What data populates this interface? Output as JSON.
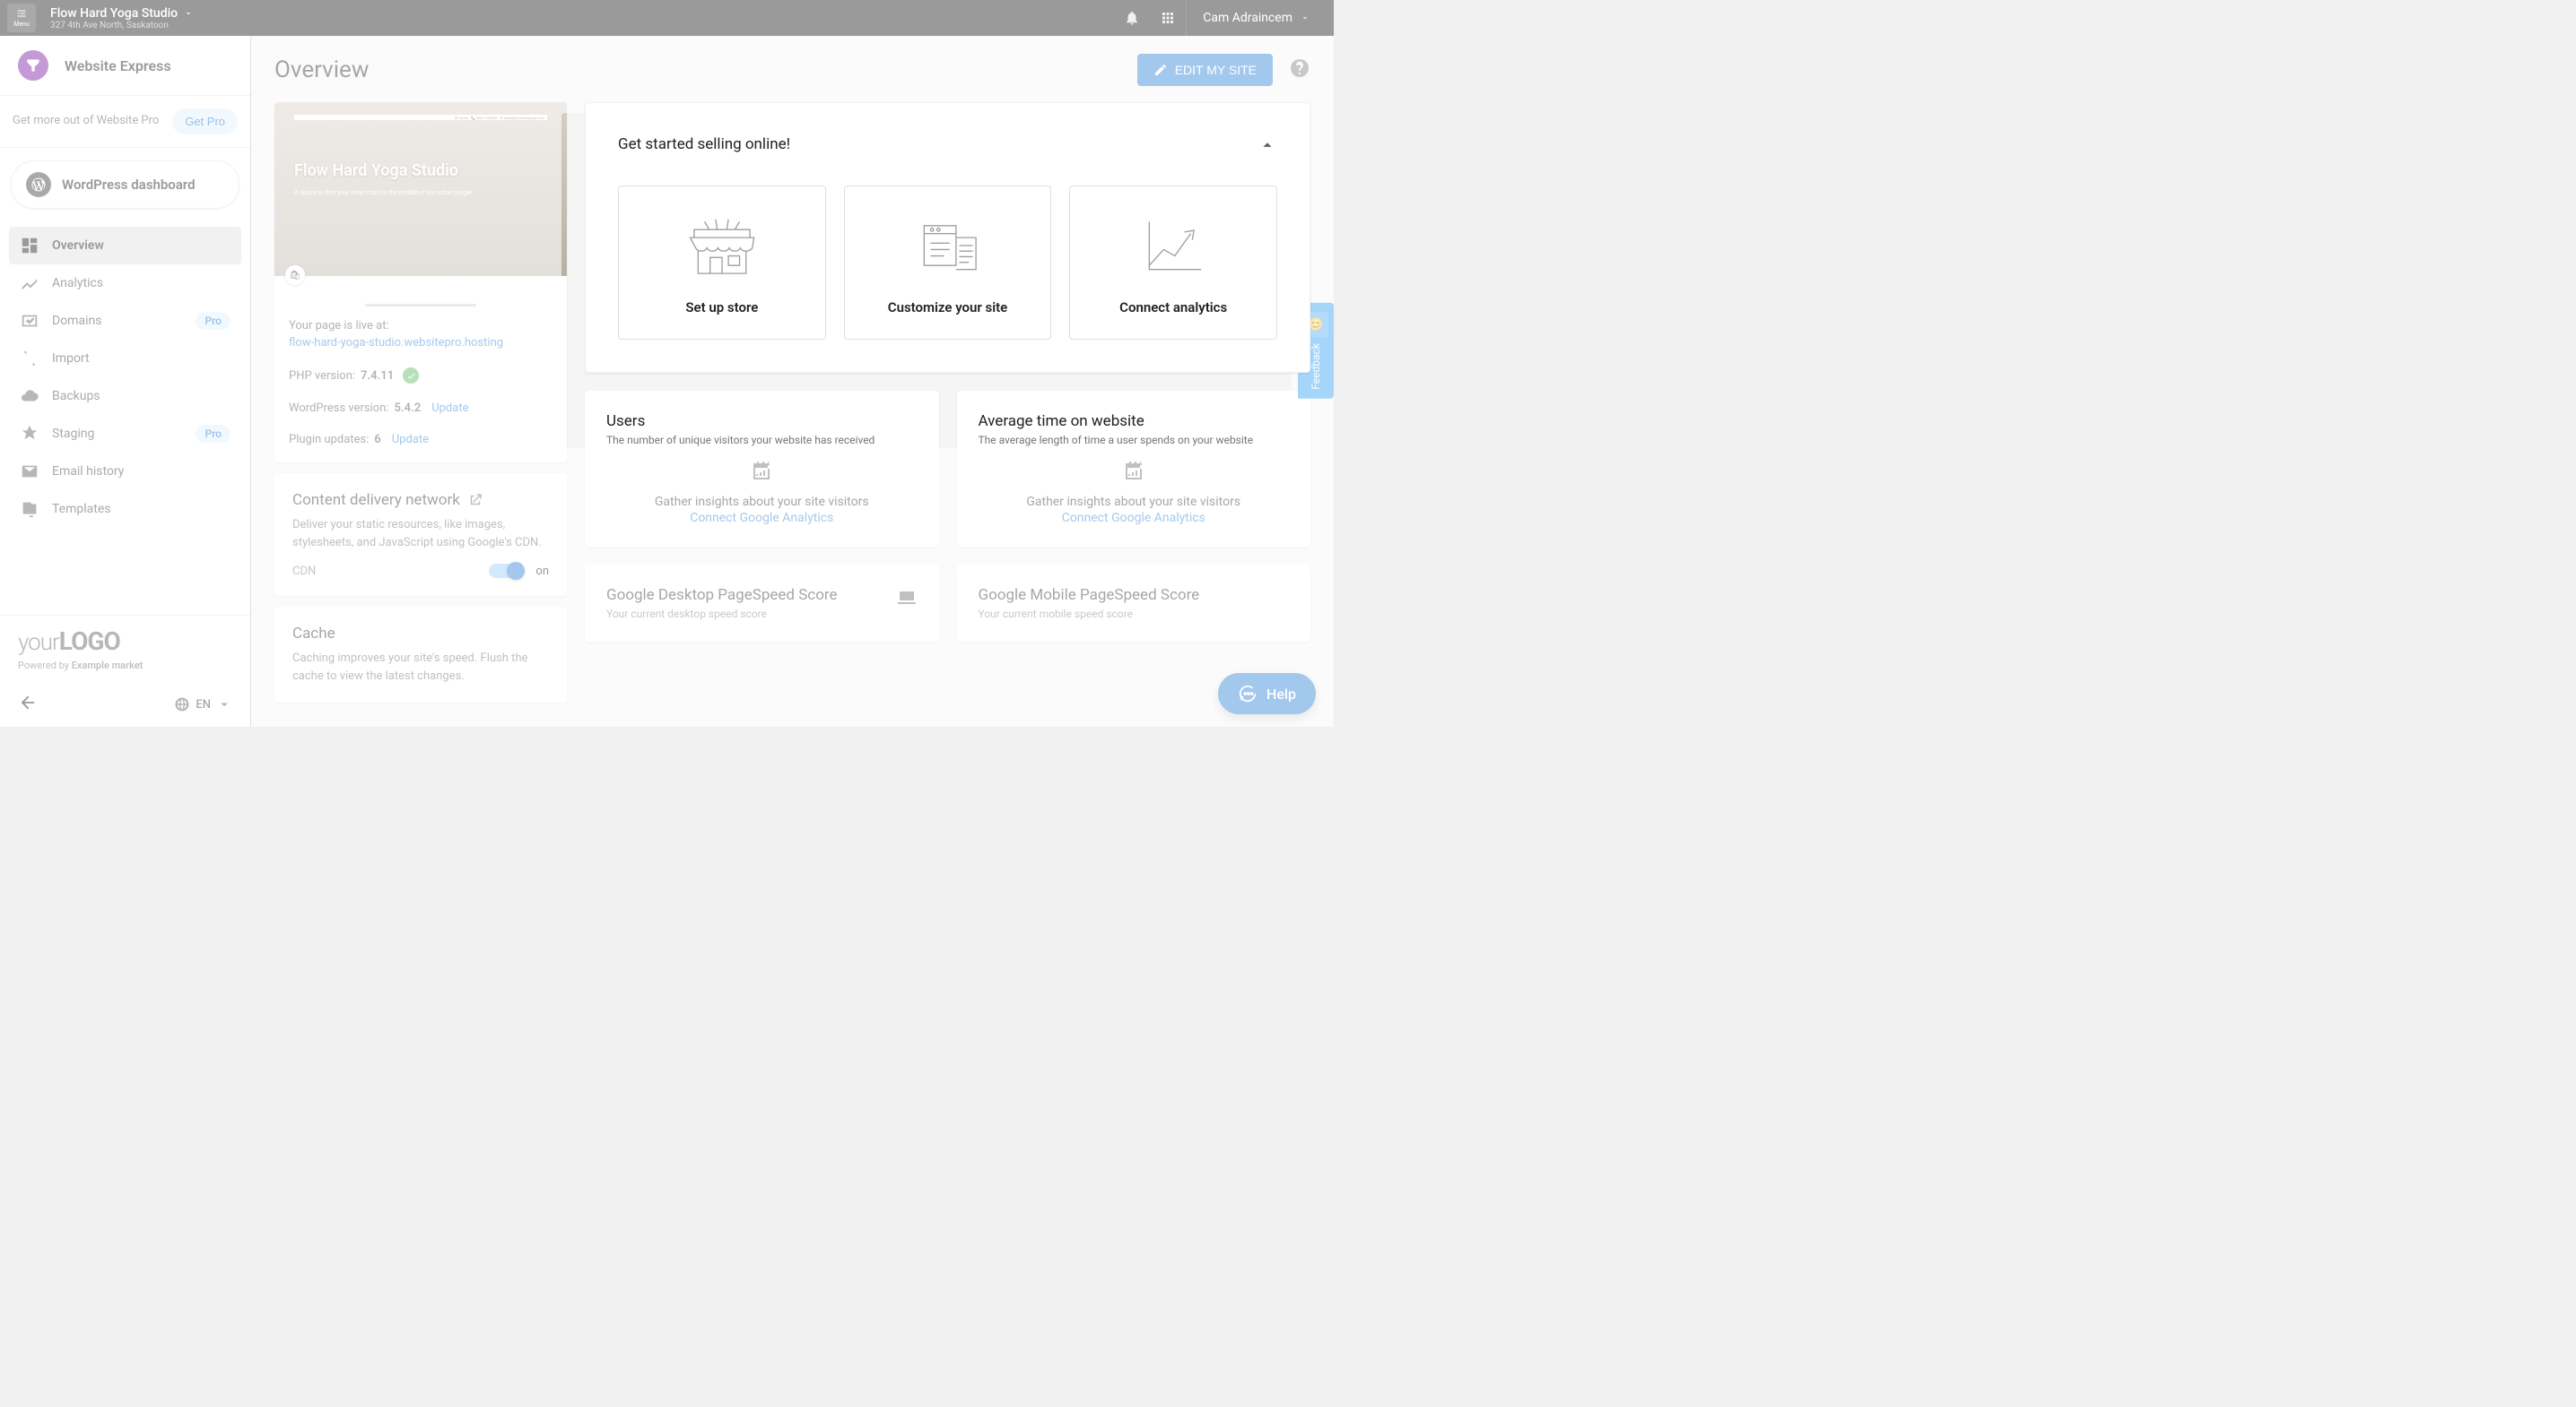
{
  "topbar": {
    "menu_label": "Menu",
    "studio_name": "Flow Hard Yoga Studio",
    "studio_address": "327 4th Ave North, Saskatoon",
    "username": "Cam Adraincem"
  },
  "sidebar": {
    "brand": "Website Express",
    "pro_banner_text": "Get more out of Website Pro",
    "get_pro_label": "Get Pro",
    "wp_dashboard_label": "WordPress dashboard",
    "nav": [
      {
        "label": "Overview",
        "icon": "dashboard",
        "active": true
      },
      {
        "label": "Analytics",
        "icon": "analytics"
      },
      {
        "label": "Domains",
        "icon": "domain",
        "badge": "Pro"
      },
      {
        "label": "Import",
        "icon": "import"
      },
      {
        "label": "Backups",
        "icon": "backup"
      },
      {
        "label": "Staging",
        "icon": "staging",
        "badge": "Pro"
      },
      {
        "label": "Email history",
        "icon": "email"
      },
      {
        "label": "Templates",
        "icon": "templates"
      }
    ],
    "logo_prefix": "your",
    "logo_suffix": "LOGO",
    "powered_prefix": "Powered by ",
    "powered_market": "Example market",
    "language": "EN"
  },
  "main": {
    "title": "Overview",
    "edit_button": "Edit my site"
  },
  "site_card": {
    "preview_title": "Flow Hard Yoga Studio",
    "preview_sub": "A space to find your inner calm in the middle of the urban jungle",
    "live_text": "Your page is live at:",
    "url": "flow-hard-yoga-studio.websitepro.hosting",
    "php_label": "PHP version: ",
    "php_version": "7.4.11",
    "wp_label": "WordPress version: ",
    "wp_version": "5.4.2",
    "wp_update": "Update",
    "plugin_label": "Plugin updates: ",
    "plugin_count": "6",
    "plugin_update": "Update"
  },
  "cdn_card": {
    "title": "Content delivery network",
    "description": "Deliver your static resources, like images, stylesheets, and JavaScript using Google's CDN.",
    "cdn_label": "CDN",
    "state": "on"
  },
  "cache_card": {
    "title": "Cache",
    "description": "Caching improves your site's speed. Flush the cache to view the latest changes."
  },
  "sell_panel": {
    "title": "Get started selling online!",
    "cards": [
      {
        "label": "Set up store"
      },
      {
        "label": "Customize your site"
      },
      {
        "label": "Connect analytics"
      }
    ]
  },
  "metrics": {
    "users": {
      "title": "Users",
      "subtitle": "The number of unique visitors your website has received",
      "cta_line": "Gather insights about your site visitors",
      "cta_link": "Connect Google Analytics"
    },
    "avg_time": {
      "title": "Average time on website",
      "subtitle": "The average length of time a user spends on your website",
      "cta_line": "Gather insights about your site visitors",
      "cta_link": "Connect Google Analytics"
    },
    "pagespeed_desktop": {
      "title": "Google Desktop PageSpeed Score",
      "subtitle": "Your current desktop speed score"
    },
    "pagespeed_mobile": {
      "title": "Google Mobile PageSpeed Score",
      "subtitle": "Your current mobile speed score"
    }
  },
  "feedback": {
    "label": "Feedback"
  },
  "help": {
    "label": "Help"
  }
}
